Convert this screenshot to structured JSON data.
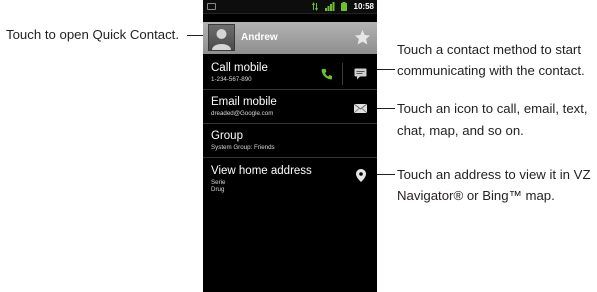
{
  "callouts": {
    "quick_contact": "Touch to open Quick Contact.",
    "contact_method_1": "Touch a contact method to start",
    "contact_method_2": "communicating with the contact.",
    "icon_1": "Touch an icon to call, email, text,",
    "icon_2": "chat, map, and so on.",
    "address_1": "Touch an address to view it in VZ",
    "address_2": "Navigator® or Bing™ map."
  },
  "status_bar": {
    "time": "10:58"
  },
  "contact": {
    "name": "Andrew"
  },
  "rows": [
    {
      "title": "Call mobile",
      "subtitle": "1-234-567-890"
    },
    {
      "title": "Email mobile",
      "subtitle": "dreaded@Google.com"
    },
    {
      "title": "Group",
      "subtitle": "System Group: Friends"
    },
    {
      "title": "View home address",
      "subtitle": "Serie",
      "subtitle2": "Drug"
    }
  ],
  "icons": {
    "notification": "notification-icon",
    "signal": "signal-icon",
    "battery": "battery-icon",
    "avatar": "contact-avatar",
    "star": "star-icon",
    "phone": "phone-icon",
    "message": "message-icon",
    "email": "email-icon",
    "map_pin": "map-pin-icon"
  },
  "colors": {
    "accent_green": "#6dbf2e",
    "header_gray": "#a0a0a0",
    "screen_bg": "#000000"
  }
}
